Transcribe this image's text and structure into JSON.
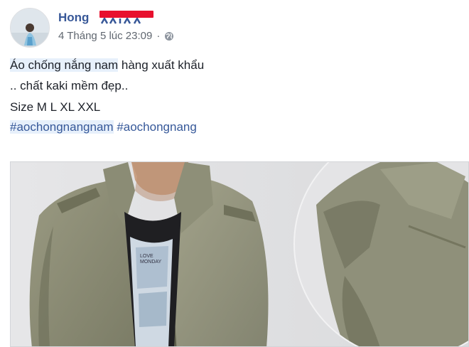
{
  "post": {
    "author": "Hong",
    "timestamp": "4 Tháng 5 lúc 23:09",
    "separator": "·",
    "privacy_icon": "globe-icon",
    "lines": {
      "line1_highlight": "Áo chống nắng nam",
      "line1_rest": " hàng xuất khẩu",
      "line2": ".. chất kaki mềm đẹp..",
      "line3": "Size M L XL XXL"
    },
    "hashtags": [
      "#aochongnangnam",
      "#aochongnang"
    ]
  },
  "colors": {
    "author": "#385898",
    "link": "#365899",
    "meta": "#606770",
    "highlight": "#e7f0fb",
    "redaction": "#e8102e"
  }
}
